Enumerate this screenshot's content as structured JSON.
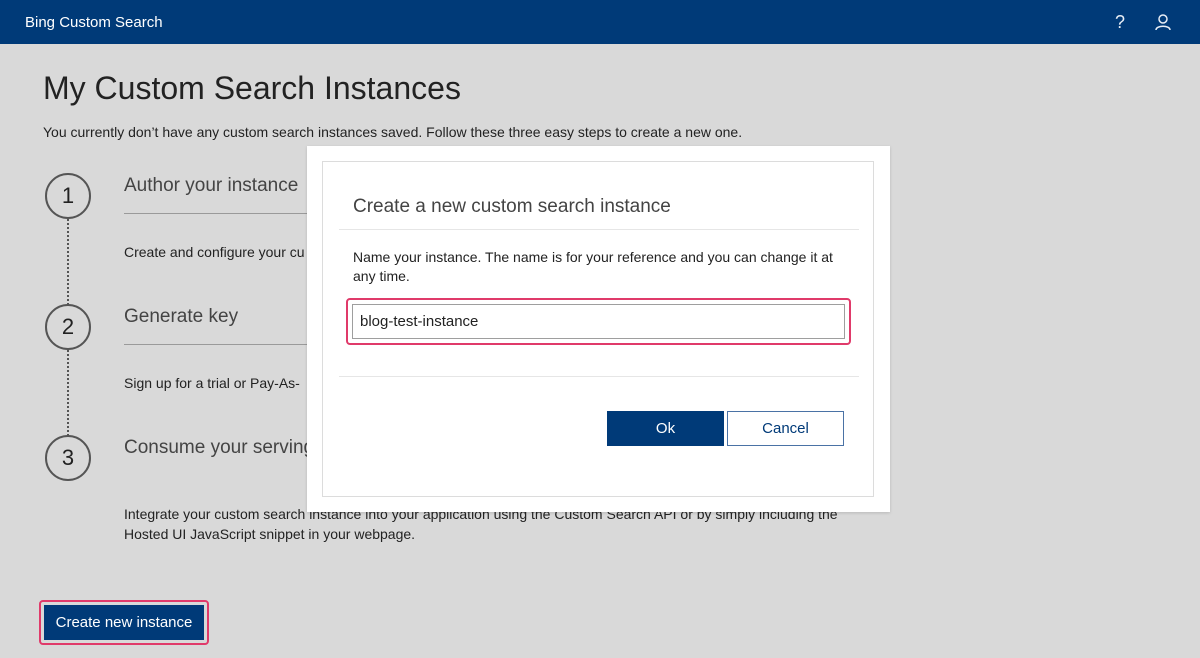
{
  "header": {
    "app_title": "Bing Custom Search",
    "help_icon": "help-icon",
    "user_icon": "user-icon",
    "bg_color": "#003a78"
  },
  "page": {
    "title": "My Custom Search Instances",
    "intro": "You currently don’t have any custom search instances saved. Follow these three easy steps to create a new one.",
    "steps": [
      {
        "number": "1",
        "title": "Author your instance",
        "description": "Create and configure your cu"
      },
      {
        "number": "2",
        "title": "Generate key",
        "description": "Sign up for a trial or Pay-As-"
      },
      {
        "number": "3",
        "title": "Consume your serving",
        "description": "Integrate your custom search instance into your application using the Custom Search API or by simply including the Hosted UI JavaScript snippet in your webpage."
      }
    ],
    "create_button_label": "Create new instance"
  },
  "modal": {
    "title": "Create a new custom search instance",
    "description": "Name your instance. The name is for your reference and you can change it at any time.",
    "name_value": "blog-test-instance",
    "ok_label": "Ok",
    "cancel_label": "Cancel"
  },
  "colors": {
    "primary": "#003a78",
    "highlight": "#e03a6a",
    "background": "#d9d9d9"
  }
}
